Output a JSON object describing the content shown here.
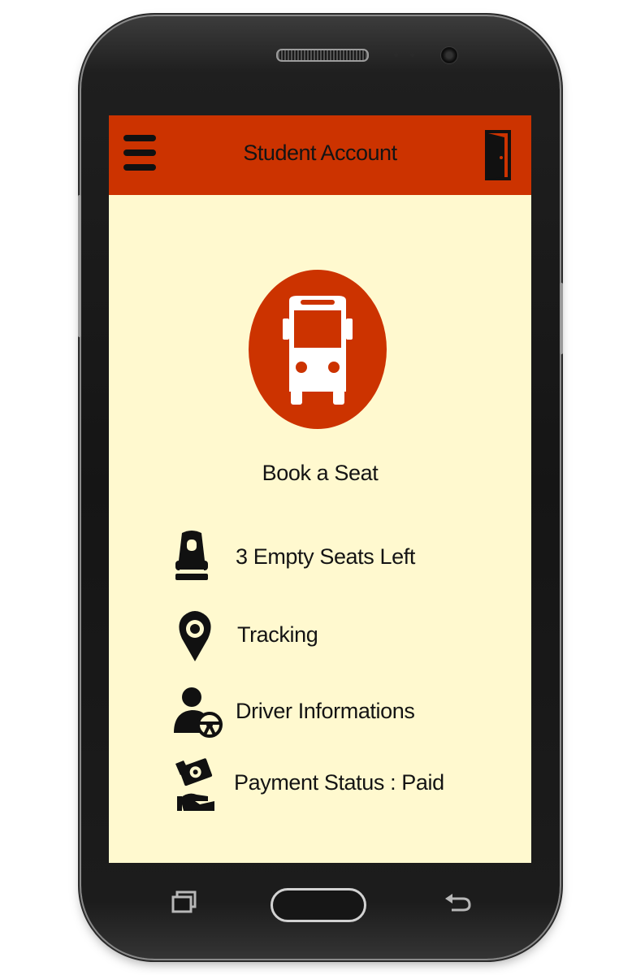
{
  "header": {
    "title": "Student Account"
  },
  "book": {
    "label": "Book a Seat"
  },
  "items": [
    {
      "label": "3 Empty Seats Left",
      "icon": "seat-icon"
    },
    {
      "label": "Tracking",
      "icon": "location-pin-icon"
    },
    {
      "label": "Driver Informations",
      "icon": "driver-icon"
    },
    {
      "label": "Payment Status : Paid",
      "icon": "payment-icon"
    }
  ],
  "colors": {
    "accent": "#cc3300",
    "background": "#fff9cf",
    "text": "#141414"
  }
}
